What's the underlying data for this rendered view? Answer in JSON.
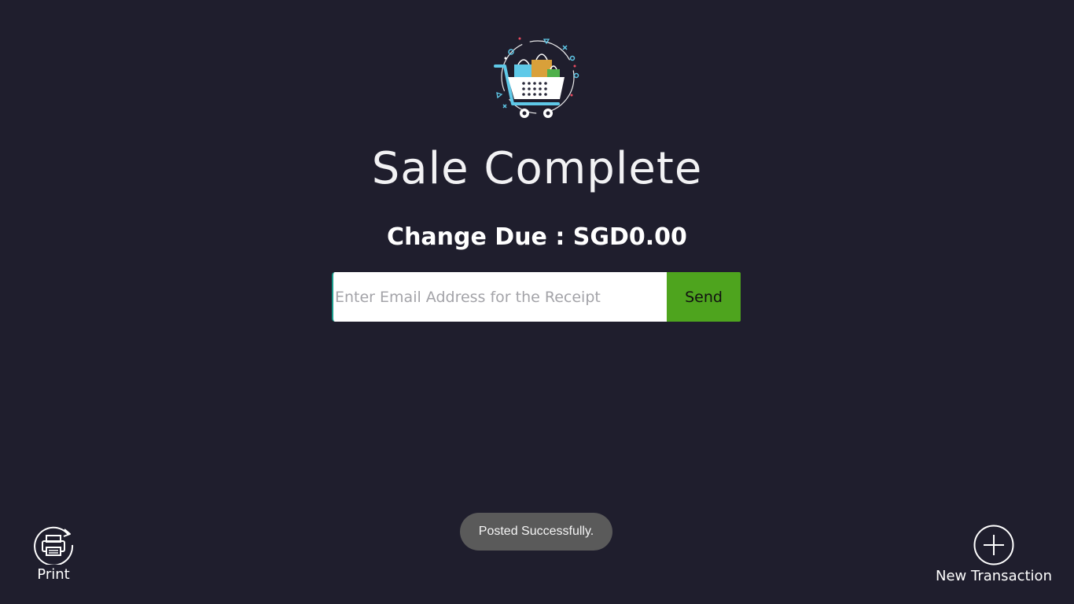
{
  "title": "Sale Complete",
  "change_due": "Change Due : SGD0.00",
  "email": {
    "placeholder": "Enter Email Address for the Receipt",
    "value": ""
  },
  "send_label": "Send",
  "toast": "Posted Successfully.",
  "actions": {
    "print_label": "Print",
    "print_icon": "print-icon",
    "new_label": "New Transaction",
    "new_icon": "plus-circle-icon"
  },
  "colors": {
    "background": "#1f1e2d",
    "send_button": "#4ea41e",
    "toast": "#5a5a5a"
  }
}
